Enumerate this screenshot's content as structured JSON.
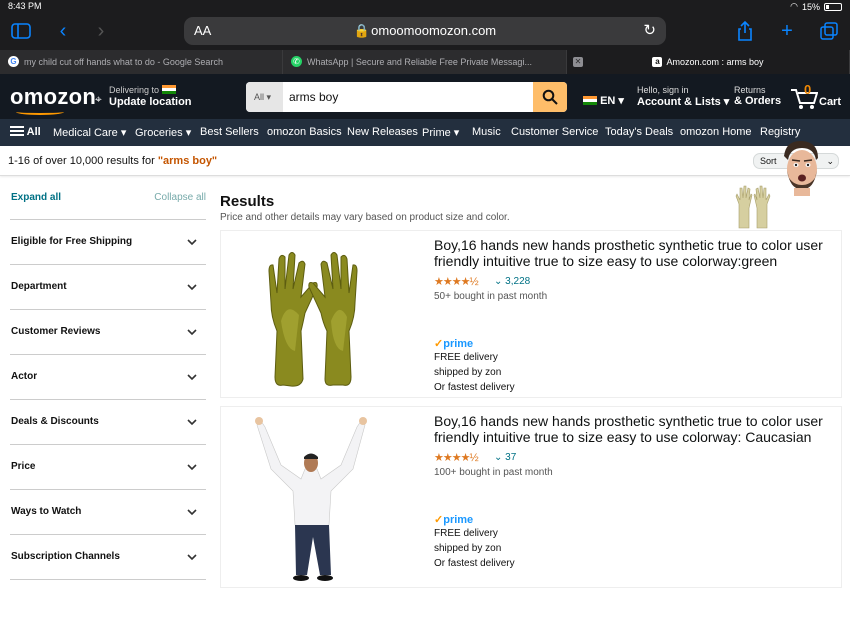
{
  "status": {
    "time": "8:43 PM",
    "battery": "15%"
  },
  "browser": {
    "text_size_label": "AA",
    "url": "omoomoomozon.com",
    "tabs": [
      {
        "label": "my child cut off hands what to do - Google Search"
      },
      {
        "label": "WhatsApp | Secure and Reliable Free Private Messagi..."
      },
      {
        "label": "Amozon.com : arms boy"
      }
    ]
  },
  "header": {
    "logo": "omozon",
    "deliver_line1": "Delivering to",
    "deliver_line2": "Update location",
    "search_category": "All",
    "search_value": "arms boy",
    "lang": "EN",
    "account_line1": "Hello, sign in",
    "account_line2": "Account & Lists",
    "returns_line1": "Returns",
    "returns_line2": "& Orders",
    "cart_count": "0",
    "cart_label": "Cart"
  },
  "nav": {
    "all": "All",
    "items": [
      "Medical Care",
      "Groceries",
      "Best Sellers",
      "omozon Basics",
      "New Releases",
      "Prime",
      "Music",
      "Customer Service",
      "Today's Deals",
      "omozon Home",
      "Registry"
    ]
  },
  "results_bar": {
    "text": "1-16 of over 10,000 results for ",
    "query": "\"arms boy\"",
    "sort_visible": "Sort"
  },
  "sidebar": {
    "expand": "Expand all",
    "collapse": "Collapse all",
    "filters": [
      "Eligible for Free Shipping",
      "Department",
      "Customer Reviews",
      "Actor",
      "Deals & Discounts",
      "Price",
      "Ways to Watch",
      "Subscription Channels"
    ]
  },
  "main": {
    "heading": "Results",
    "subheading": "Price and other details may vary based on product size and color.",
    "products": [
      {
        "title": "Boy,16 hands new hands prosthetic synthetic true to color user friendly intuitive true to size easy to use colorway:green",
        "stars": "★★★★½",
        "rating_value": 4.5,
        "reviews": "3,228",
        "bought": "50+ bought in past month",
        "prime": "prime",
        "delivery": "FREE delivery",
        "shipped": "shipped by zon",
        "fastest": "Or fastest delivery"
      },
      {
        "title": "Boy,16 hands new hands prosthetic synthetic true to color user friendly intuitive true to size easy to use colorway: Caucasian",
        "stars": "★★★★½",
        "rating_value": 4.5,
        "reviews": "37",
        "bought": "100+ bought in past month",
        "prime": "prime",
        "delivery": "FREE delivery",
        "shipped": "shipped by zon",
        "fastest": "Or fastest delivery"
      }
    ]
  },
  "colors": {
    "header": "#131921",
    "nav": "#232f3e",
    "accent": "#ff9900",
    "search_button": "#febd69",
    "link": "#007185",
    "query": "#c45500",
    "stars": "#de7921",
    "prime": "#1a98ff"
  }
}
